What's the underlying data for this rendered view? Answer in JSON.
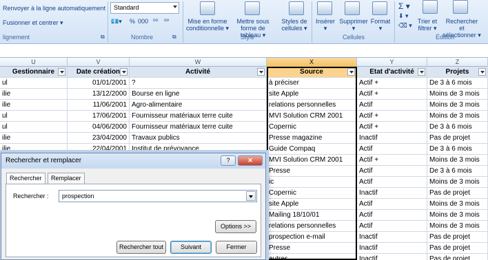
{
  "ribbon": {
    "alignment": {
      "wrap_text": "Renvoyer à la ligne automatiquement",
      "merge_center": "Fusionner et centrer",
      "group_name": "lignement"
    },
    "number": {
      "format_value": "Standard",
      "percent": "%",
      "thousands": "000",
      "group_name": "Nombre"
    },
    "style": {
      "conditional": "Mise en forme conditionnelle",
      "as_table": "Mettre sous forme de tableau",
      "cell_styles": "Styles de cellules",
      "group_name": "Style"
    },
    "cells": {
      "insert": "Insérer",
      "delete": "Supprimer",
      "format": "Format",
      "group_name": "Cellules"
    },
    "editing": {
      "sort": "Trier et filtrer",
      "find": "Rechercher et sélectionner",
      "group_name": "Édition"
    }
  },
  "columns": [
    "U",
    "V",
    "W",
    "X",
    "Y",
    "Z"
  ],
  "selected_column": "X",
  "headers": [
    "Gestionnaire",
    "Date création",
    "Activité",
    "Source",
    "Etat d'activité",
    "Projets"
  ],
  "rows": [
    [
      "ul",
      "01/01/2001",
      "?",
      "à préciser",
      "Actif +",
      "De 3 à 6 mois"
    ],
    [
      "ilie",
      "13/12/2000",
      "Bourse en ligne",
      "site Apple",
      "Actif +",
      "Moins de 3 mois"
    ],
    [
      "ilie",
      "11/06/2001",
      "Agro-alimentaire",
      "relations personnelles",
      "Actif",
      "Moins de 3 mois"
    ],
    [
      "ul",
      "17/06/2001",
      "Fournisseur matériaux terre cuite",
      "MVI Solution CRM 2001",
      "Actif +",
      "Moins de 3 mois"
    ],
    [
      "ul",
      "04/06/2000",
      "Fournisseur matériaux terre cuite",
      "Copernic",
      "Actif +",
      "De 3 à 6 mois"
    ],
    [
      "ilie",
      "23/04/2000",
      "Travaux publics",
      "Presse magazine",
      "Inactif",
      "Pas de projet"
    ],
    [
      "ilie",
      "22/04/2001",
      "Institut de prévoyance",
      "Guide Compaq",
      "Actif",
      "De 3 à 6 mois"
    ],
    [
      "",
      "",
      "",
      "MVI Solution CRM 2001",
      "Actif +",
      "Moins de 3 mois"
    ],
    [
      "",
      "",
      "",
      "Presse",
      "Actif",
      "De 3 à 6 mois"
    ],
    [
      "",
      "",
      "",
      "ic",
      "Actif",
      "Moins de 3 mois"
    ],
    [
      "",
      "",
      "",
      "Copernic",
      "Inactif",
      "Pas de projet"
    ],
    [
      "",
      "",
      "",
      "site Apple",
      "Actif",
      "Moins de 3 mois"
    ],
    [
      "",
      "",
      "",
      "Mailing 18/10/01",
      "Actif",
      "Moins de 3 mois"
    ],
    [
      "",
      "",
      "",
      "relations personnelles",
      "Actif",
      "Moins de 3 mois"
    ],
    [
      "",
      "",
      "",
      "prospection e-mail",
      "Inactif",
      "Pas de projet"
    ],
    [
      "",
      "",
      "",
      "Presse",
      "Inactif",
      "Pas de projet"
    ],
    [
      "",
      "",
      "",
      "autres",
      "Inactif",
      "Pas de projet"
    ]
  ],
  "dialog": {
    "title": "Rechercher et remplacer",
    "help": "?",
    "close": "✕",
    "tab_find": "Rechercher",
    "tab_replace": "Remplacer",
    "find_label": "Rechercher :",
    "find_value": "prospection",
    "options": "Options >>",
    "find_all": "Rechercher tout",
    "find_next": "Suivant",
    "close_button": "Fermer"
  },
  "colors": {
    "ribbon_text": "#15428b",
    "header_fill": "#dbe5f1",
    "selected_header": "#fbd38d"
  }
}
